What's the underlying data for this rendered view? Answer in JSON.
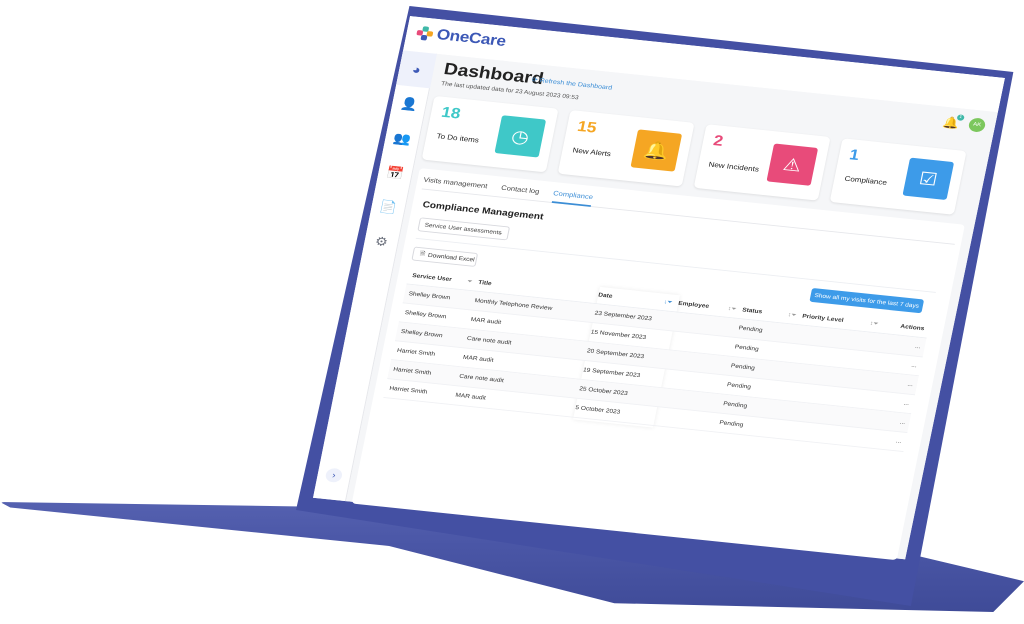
{
  "app": {
    "logo_text": "OneCare",
    "logo_colors": [
      "#e84b7a",
      "#3fb8a8",
      "#f5a623",
      "#3c58b6"
    ]
  },
  "sidebar": {
    "items": [
      {
        "icon": "pie-chart-icon",
        "glyph": "◕",
        "active": true
      },
      {
        "icon": "user-icon",
        "glyph": "👤",
        "active": false
      },
      {
        "icon": "employee-icon",
        "glyph": "👥",
        "active": false
      },
      {
        "icon": "calendar-icon",
        "glyph": "📅",
        "active": false
      },
      {
        "icon": "document-icon",
        "glyph": "📄",
        "active": false
      },
      {
        "icon": "gear-icon",
        "glyph": "⚙",
        "active": false
      }
    ],
    "expand_glyph": "›"
  },
  "header": {
    "title": "Dashboard",
    "refresh_label": "Refresh the Dashboard",
    "last_updated": "The last updated data for 23 August 2023 09:53",
    "bell_badge": "1",
    "avatar_initials": "AK"
  },
  "cards": [
    {
      "count": "18",
      "label": "To Do items",
      "color": "#3fc8c8",
      "icon_glyph": "◷",
      "icon": "clock-icon"
    },
    {
      "count": "15",
      "label": "New Alerts",
      "color": "#f5a623",
      "icon_glyph": "🔔",
      "icon": "bell-icon"
    },
    {
      "count": "2",
      "label": "New Incidents",
      "color": "#e84b7a",
      "icon_glyph": "⚠",
      "icon": "warning-icon"
    },
    {
      "count": "1",
      "label": "Compliance",
      "color": "#3d9be9",
      "icon_glyph": "☑",
      "icon": "checklist-icon"
    }
  ],
  "tabs": [
    {
      "label": "Visits management",
      "active": false
    },
    {
      "label": "Contact log",
      "active": false
    },
    {
      "label": "Compliance",
      "active": true
    }
  ],
  "compliance": {
    "title": "Compliance Management",
    "select_value": "Service User assessments",
    "download_label": "Download Excel",
    "show_visits_label": "Show all my visits for the last 7 days"
  },
  "table": {
    "headers": [
      "Service User",
      "Title",
      "Date",
      "Employee",
      "Status",
      "Priority Level",
      "Actions"
    ],
    "rows": [
      {
        "user": "Shelley Brown",
        "title": "Monthly Telephone Review",
        "date": "23 September 2023",
        "employee": "",
        "status": "Pending",
        "priority": "",
        "actions": "..."
      },
      {
        "user": "Shelley Brown",
        "title": "MAR audit",
        "date": "15 November 2023",
        "employee": "",
        "status": "Pending",
        "priority": "",
        "actions": "..."
      },
      {
        "user": "Shelley Brown",
        "title": "Care note audit",
        "date": "20 September 2023",
        "employee": "",
        "status": "Pending",
        "priority": "",
        "actions": "..."
      },
      {
        "user": "Harriet Smith",
        "title": "MAR audit",
        "date": "19 September 2023",
        "employee": "",
        "status": "Pending",
        "priority": "",
        "actions": "..."
      },
      {
        "user": "Harriet Smith",
        "title": "Care note audit",
        "date": "25 October 2023",
        "employee": "",
        "status": "Pending",
        "priority": "",
        "actions": "..."
      },
      {
        "user": "Harriet Smith",
        "title": "MAR audit",
        "date": "5 October 2023",
        "employee": "",
        "status": "Pending",
        "priority": "",
        "actions": "..."
      }
    ]
  }
}
